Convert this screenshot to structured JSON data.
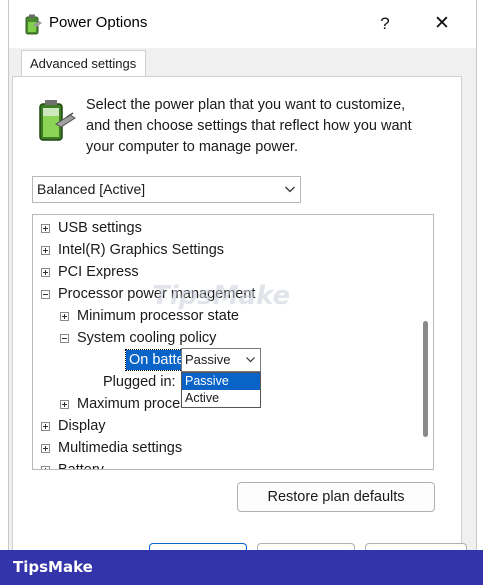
{
  "window": {
    "title": "Power Options",
    "help_label": "?",
    "close_label": "✕"
  },
  "tab": {
    "label": "Advanced settings"
  },
  "intro": {
    "line1": "Select the power plan that you want to customize,",
    "line2": "and then choose settings that reflect how you want",
    "line3": "your computer to manage power."
  },
  "plan_select": {
    "value": "Balanced [Active]"
  },
  "tree": {
    "items": [
      {
        "label": "USB settings",
        "expander": "+"
      },
      {
        "label": "Intel(R) Graphics Settings",
        "expander": "+"
      },
      {
        "label": "PCI Express",
        "expander": "+"
      },
      {
        "label": "Processor power management",
        "expander": "-"
      },
      {
        "label": "Minimum processor state",
        "expander": "+"
      },
      {
        "label": "System cooling policy",
        "expander": "-"
      },
      {
        "label": "On battery:",
        "expander": ""
      },
      {
        "label": "Plugged in:",
        "expander": ""
      },
      {
        "label": "Maximum processor state",
        "expander": "+"
      },
      {
        "label": "Display",
        "expander": "+"
      },
      {
        "label": "Multimedia settings",
        "expander": "+"
      },
      {
        "label": "Battery",
        "expander": "+"
      }
    ]
  },
  "on_battery": {
    "value": "Passive",
    "options": [
      "Passive",
      "Active"
    ],
    "selected_option": "Passive"
  },
  "restore_button": {
    "label": "Restore plan defaults"
  },
  "footer": {
    "brand": "TipsMake"
  },
  "watermark": {
    "text": "TipsMake"
  },
  "colors": {
    "accent": "#0a64c8",
    "footer_band": "#3333aa",
    "dialog_bg": "#f0f0f0"
  }
}
